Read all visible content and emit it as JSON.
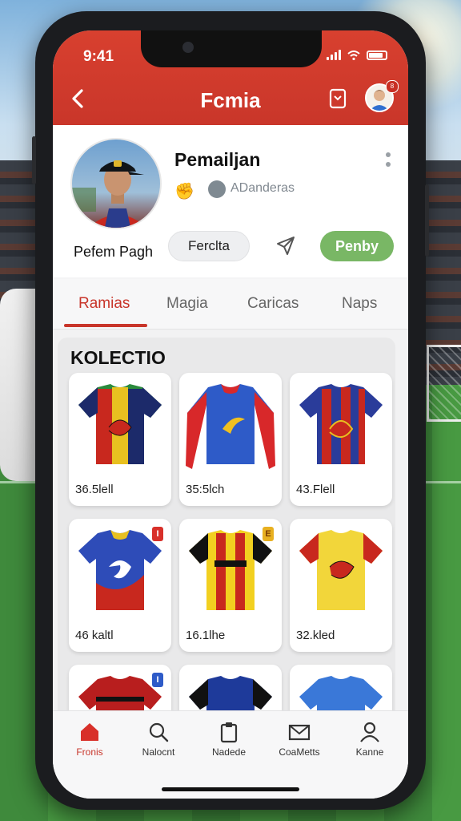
{
  "status": {
    "time": "9:41"
  },
  "header": {
    "title": "Fcmia"
  },
  "profile": {
    "name": "Pemailjan",
    "club": "ADanderas",
    "caption": "Pefem Pagh",
    "follow_label": "Ferclta",
    "primary_label": "Penby",
    "avatar_badge": "8"
  },
  "tabs": [
    {
      "label": "Ramias",
      "active": true
    },
    {
      "label": "Magia",
      "active": false
    },
    {
      "label": "Caricas",
      "active": false
    },
    {
      "label": "Naps",
      "active": false
    }
  ],
  "collection": {
    "title": "KOLECTIO",
    "items": [
      {
        "price": "36.5lell",
        "badge": ""
      },
      {
        "price": "35:5lch",
        "badge": ""
      },
      {
        "price": "43.Flell",
        "badge": ""
      },
      {
        "price": "46 kaltl",
        "badge": "I"
      },
      {
        "price": "16.1lhe",
        "badge": "E"
      },
      {
        "price": "32.kled",
        "badge": ""
      },
      {
        "price": "",
        "badge": "I"
      },
      {
        "price": "",
        "badge": ""
      },
      {
        "price": "",
        "badge": ""
      }
    ]
  },
  "bottom_nav": [
    {
      "label": "Fronis",
      "icon": "home-icon",
      "active": true
    },
    {
      "label": "Nalocnt",
      "icon": "search-icon",
      "active": false
    },
    {
      "label": "Nadede",
      "icon": "clipboard-icon",
      "active": false
    },
    {
      "label": "CoaMetts",
      "icon": "mail-icon",
      "active": false
    },
    {
      "label": "Kanne",
      "icon": "user-icon",
      "active": false
    }
  ],
  "colors": {
    "accent": "#c8352a",
    "primary_button": "#79b765",
    "header": "#d23c2d"
  }
}
